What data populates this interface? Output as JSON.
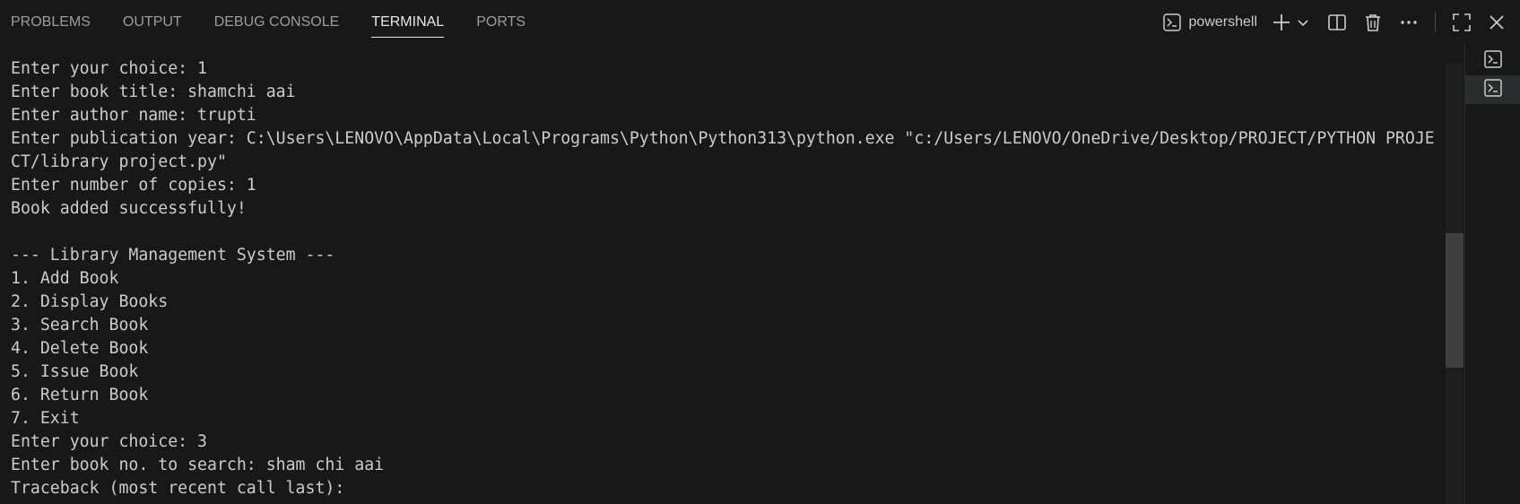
{
  "tabs": [
    {
      "label": "PROBLEMS",
      "active": false
    },
    {
      "label": "OUTPUT",
      "active": false
    },
    {
      "label": "DEBUG CONSOLE",
      "active": false
    },
    {
      "label": "TERMINAL",
      "active": true
    },
    {
      "label": "PORTS",
      "active": false
    }
  ],
  "toolbar": {
    "shell_label": "powershell",
    "icons": [
      "terminal-icon",
      "plus-icon",
      "chevron-down-icon",
      "split-icon",
      "trash-icon",
      "more-icon",
      "maximize-icon",
      "close-icon"
    ]
  },
  "terminal": {
    "lines": [
      "Enter your choice: 1",
      "Enter book title: shamchi aai",
      "Enter author name: trupti",
      "Enter publication year: C:\\Users\\LENOVO\\AppData\\Local\\Programs\\Python\\Python313\\python.exe \"c:/Users/LENOVO/OneDrive/Desktop/PROJECT/PYTHON PROJE",
      "CT/library project.py\"",
      "Enter number of copies: 1",
      "Book added successfully!",
      "",
      "--- Library Management System ---",
      "1. Add Book",
      "2. Display Books",
      "3. Search Book",
      "4. Delete Book",
      "5. Issue Book",
      "6. Return Book",
      "7. Exit",
      "Enter your choice: 3",
      "Enter book no. to search: sham chi aai",
      "Traceback (most recent call last):"
    ]
  },
  "side_terminals": [
    {
      "icon": "terminal-icon",
      "active": false
    },
    {
      "icon": "terminal-icon",
      "active": true
    }
  ],
  "colors": {
    "background": "#181818",
    "text": "#cccccc",
    "active_tab": "#e7e7e7",
    "inactive_tab": "#9d9d9d"
  }
}
